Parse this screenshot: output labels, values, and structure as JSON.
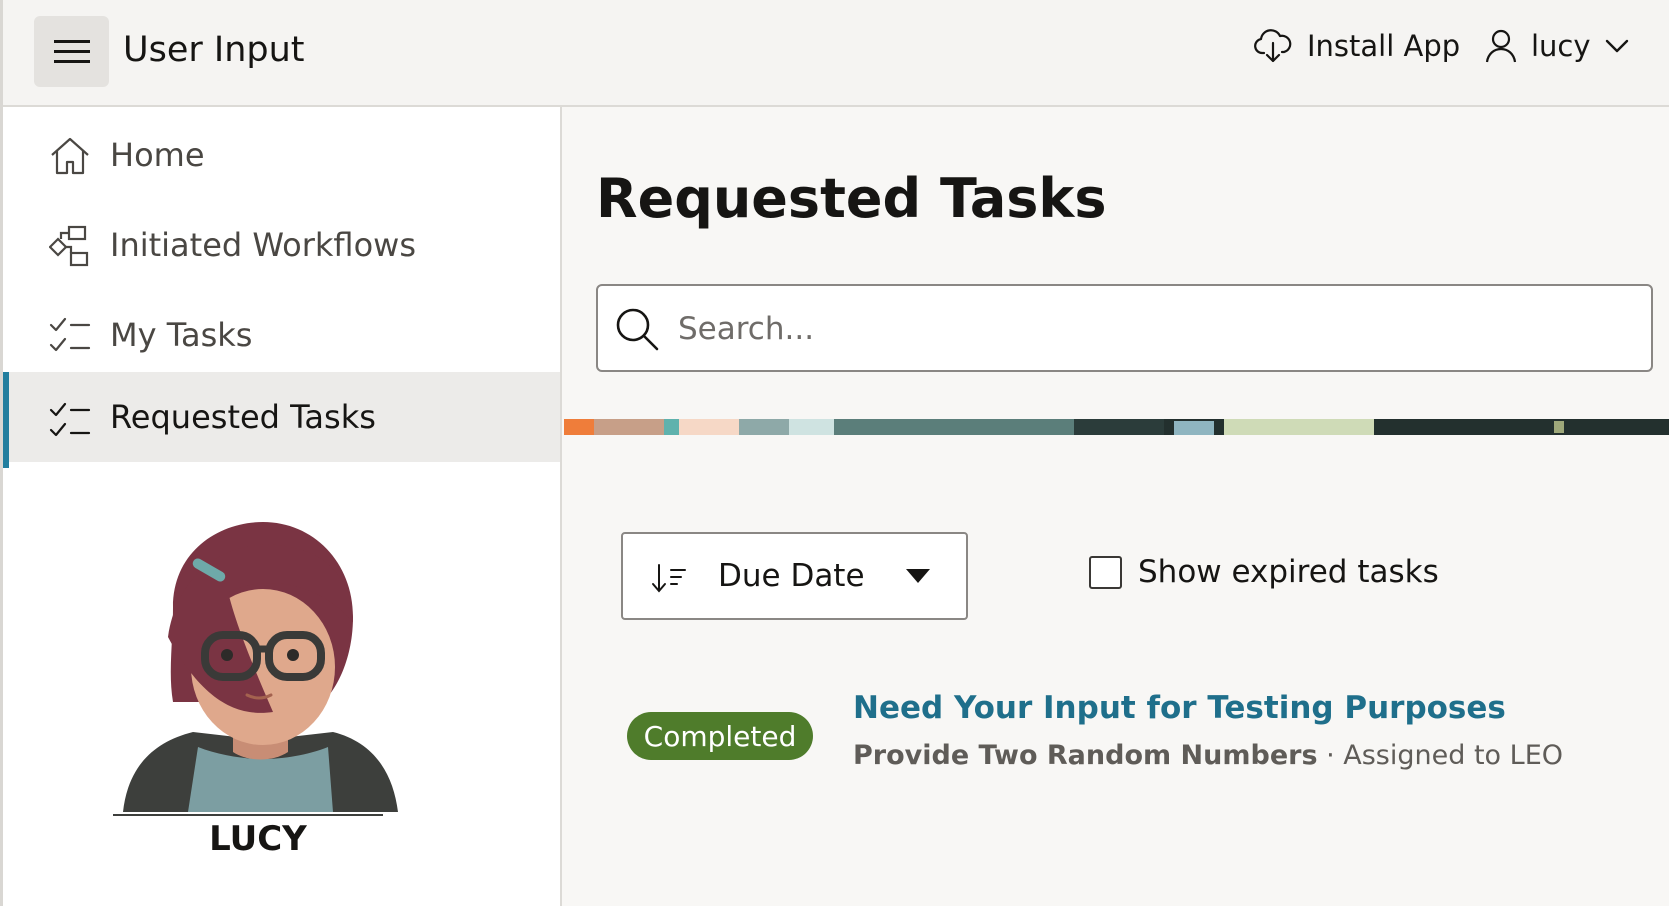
{
  "header": {
    "title": "User Input",
    "install_label": "Install App",
    "user_name": "lucy"
  },
  "sidebar": {
    "items": [
      {
        "label": "Home",
        "icon": "home-icon"
      },
      {
        "label": "Initiated Workflows",
        "icon": "workflow-icon"
      },
      {
        "label": "My Tasks",
        "icon": "checklist-icon"
      },
      {
        "label": "Requested Tasks",
        "icon": "checklist-icon",
        "active": true
      }
    ],
    "avatar_name": "LUCY"
  },
  "main": {
    "title": "Requested Tasks",
    "search_placeholder": "Search...",
    "sort_value": "Due Date",
    "expired_label": "Show expired tasks",
    "expired_checked": false,
    "tasks": [
      {
        "status": "Completed",
        "title": "Need Your Input for Testing Purposes",
        "subtitle": "Provide Two Random Numbers",
        "assigned": "· Assigned to LEO"
      }
    ]
  },
  "colors": {
    "accent": "#227e9e",
    "link": "#1f6f8b",
    "status_completed": "#4f7c2b"
  }
}
